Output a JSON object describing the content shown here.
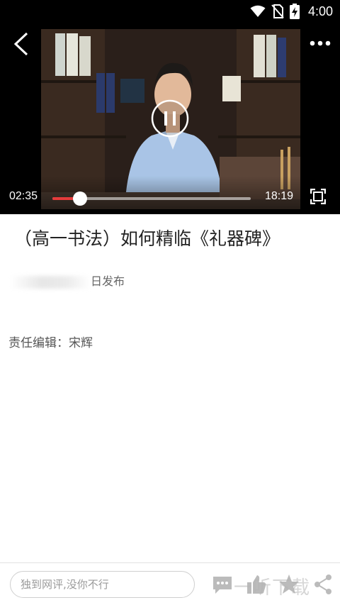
{
  "status_bar": {
    "time": "4:00",
    "icons": [
      "wifi-icon",
      "no-sim-icon",
      "battery-charging-icon"
    ]
  },
  "video": {
    "current_time": "02:35",
    "total_time": "18:19",
    "progress_fraction": 0.141,
    "state": "playing",
    "progress_color": "#e63b3b",
    "controls": [
      "back-arrow-icon",
      "more-dots-icon",
      "pause-icon",
      "fullscreen-icon"
    ]
  },
  "article": {
    "title": "（高一书法）如何精临《礼器碑》",
    "publish_suffix": "日发布",
    "editor": "责任编辑：宋辉"
  },
  "bottom_bar": {
    "comment_placeholder": "独到网评,没你不行",
    "icons": [
      "comment-icon",
      "like-icon",
      "star-icon",
      "share-icon"
    ]
  },
  "watermark": {
    "text": "一听下载"
  }
}
